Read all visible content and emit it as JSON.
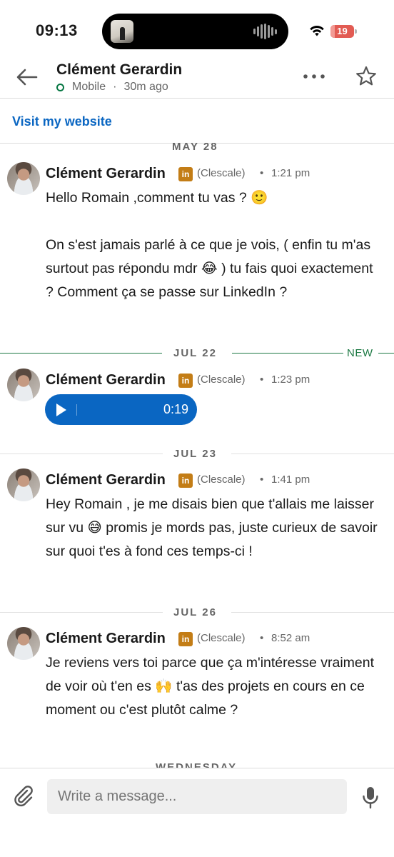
{
  "status_bar": {
    "time": "09:13",
    "battery": "19",
    "battery_level_percent": 19,
    "battery_color": "#e25b53"
  },
  "header": {
    "name": "Clément Gerardin",
    "device": "Mobile",
    "separator": "·",
    "last_seen": "30m ago",
    "icons": [
      "back-arrow-icon",
      "more-icon",
      "star-icon"
    ]
  },
  "website_link": "Visit my website",
  "dates": {
    "may28": "MAY 28",
    "jul22": "JUL 22",
    "new_label": "NEW",
    "jul23": "JUL 23",
    "jul26": "JUL 26",
    "wednesday_partial": "WEDNESDAY"
  },
  "messages": [
    {
      "sender": "Clément Gerardin",
      "badge": "in",
      "alias": "(Clescale)",
      "dot": "•",
      "time": "1:21 pm",
      "paragraphs": [
        "Hello Romain ,comment tu vas ? 🙂",
        "On s'est jamais parlé à ce que je vois, ( enfin tu m'as surtout pas répondu mdr 😂 ) tu fais quoi exactement ? Comment ça se passe sur LinkedIn ?"
      ]
    },
    {
      "sender": "Clément Gerardin",
      "badge": "in",
      "alias": "(Clescale)",
      "dot": "•",
      "time": "1:23 pm",
      "voice_duration": "0:19"
    },
    {
      "sender": "Clément Gerardin",
      "badge": "in",
      "alias": "(Clescale)",
      "dot": "•",
      "time": "1:41 pm",
      "paragraphs": [
        "Hey Romain , je me disais bien que t'allais me laisser sur vu 😅 promis je mords pas, juste curieux de savoir sur quoi t'es à fond ces temps-ci !"
      ]
    },
    {
      "sender": "Clément Gerardin",
      "badge": "in",
      "alias": "(Clescale)",
      "dot": "•",
      "time": "8:52 am",
      "paragraphs": [
        "Je reviens vers toi parce que ça m'intéresse vraiment de voir où t'en es 🙌 t'as des projets en cours en ce moment ou c'est plutôt calme ?"
      ]
    }
  ],
  "compose": {
    "placeholder": "Write a message..."
  },
  "colors": {
    "link_blue": "#0a66c2",
    "new_green": "#1e7a45",
    "linkedin_badge": "#c37d16",
    "online_green": "#057642"
  }
}
